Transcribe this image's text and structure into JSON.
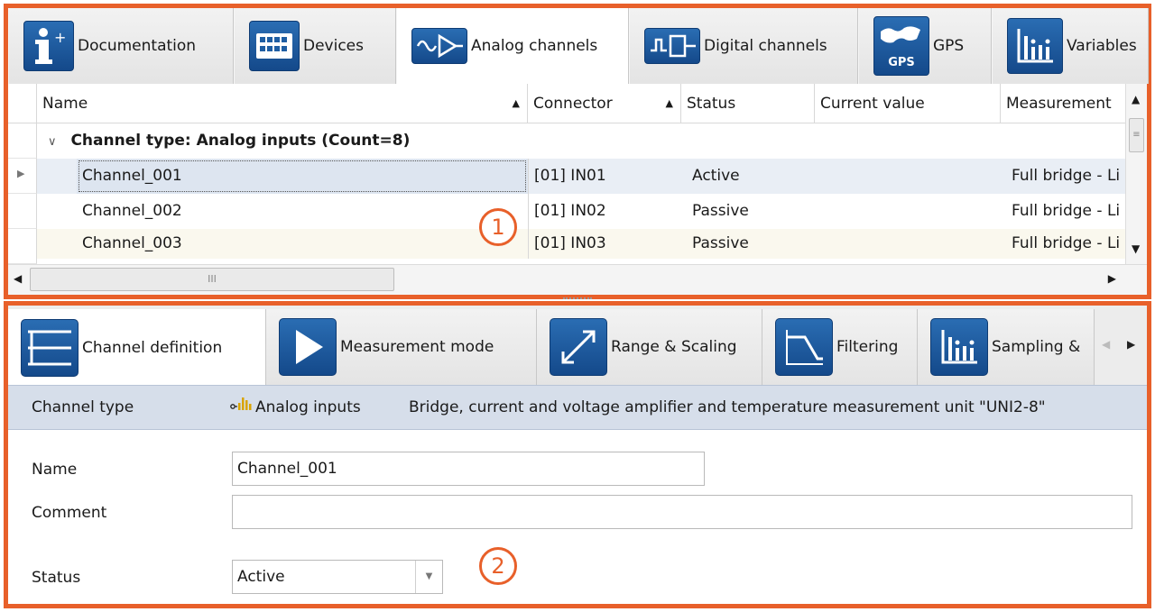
{
  "top_tabs": [
    {
      "label": "Documentation",
      "icon": "info-icon",
      "active": false
    },
    {
      "label": "Devices",
      "icon": "devices-icon",
      "active": false
    },
    {
      "label": "Analog channels",
      "icon": "analog-channels-icon",
      "active": true
    },
    {
      "label": "Digital channels",
      "icon": "digital-channels-icon",
      "active": false
    },
    {
      "label": "GPS",
      "icon": "gps-icon",
      "active": false,
      "icon_text": "GPS"
    },
    {
      "label": "Variables",
      "icon": "variables-icon",
      "active": false
    }
  ],
  "grid": {
    "columns": [
      "Name",
      "Connector",
      "Status",
      "Current value",
      "Measurement"
    ],
    "group": "Channel type: Analog inputs (Count=8)",
    "rows": [
      {
        "name": "Channel_001",
        "connector": "[01] IN01",
        "status": "Active",
        "current": "",
        "measurement": "Full bridge - Li"
      },
      {
        "name": "Channel_002",
        "connector": "[01] IN02",
        "status": "Passive",
        "current": "",
        "measurement": "Full bridge - Li"
      },
      {
        "name": "Channel_003",
        "connector": "[01] IN03",
        "status": "Passive",
        "current": "",
        "measurement": "Full bridge - Li"
      }
    ],
    "hscroll_thumb": "III"
  },
  "callouts": [
    "1",
    "2"
  ],
  "bottom_tabs": [
    {
      "label": "Channel definition",
      "icon": "channel-definition-icon",
      "active": true
    },
    {
      "label": "Measurement mode",
      "icon": "measurement-mode-icon",
      "active": false
    },
    {
      "label": "Range & Scaling",
      "icon": "range-scaling-icon",
      "active": false
    },
    {
      "label": "Filtering",
      "icon": "filtering-icon",
      "active": false
    },
    {
      "label": "Sampling &",
      "icon": "sampling-icon",
      "active": false
    }
  ],
  "info_bar": {
    "label": "Channel type",
    "type": "Analog inputs",
    "description": "Bridge, current and voltage amplifier and temperature measurement unit \"UNI2-8\""
  },
  "form": {
    "name_label": "Name",
    "name_value": "Channel_001",
    "comment_label": "Comment",
    "comment_value": "",
    "status_label": "Status",
    "status_value": "Active"
  },
  "colors": {
    "accent": "#e8602a",
    "icon_blue": "#1f5ea3",
    "info_bar": "#d6deea",
    "selected_row": "#e9eef5"
  }
}
